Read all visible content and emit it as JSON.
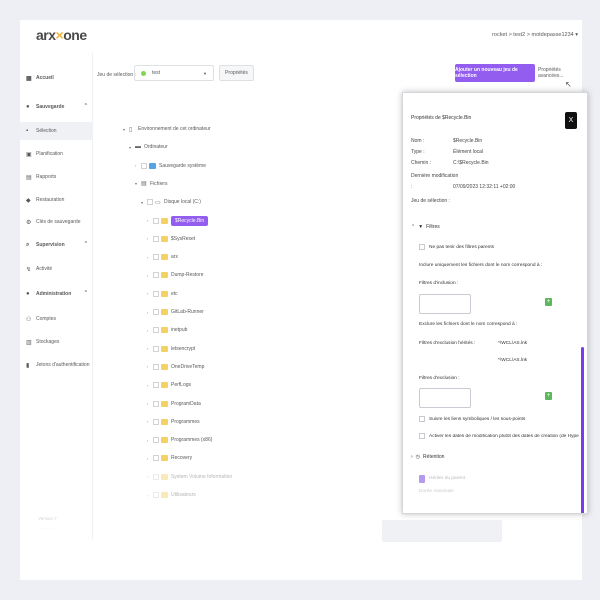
{
  "header": {
    "logo_left": "arx",
    "logo_accent": "×",
    "logo_right": "one",
    "user_menu": "rocket > test2 > motdepasse1234 ▾"
  },
  "sidebar": {
    "items": [
      {
        "label": "Accueil",
        "icon": "home-icon",
        "type": "section"
      },
      {
        "label": "Sauvegarde",
        "icon": "save-icon",
        "type": "section",
        "expanded": true
      },
      {
        "label": "Sélection",
        "icon": "file-icon",
        "type": "item",
        "active": true
      },
      {
        "label": "Planification",
        "icon": "calendar-icon",
        "type": "item"
      },
      {
        "label": "Rapports",
        "icon": "report-icon",
        "type": "item"
      },
      {
        "label": "Restauration",
        "icon": "restore-icon",
        "type": "item"
      },
      {
        "label": "Clés de sauvegarde",
        "icon": "key-icon",
        "type": "item"
      },
      {
        "label": "Supervision",
        "icon": "search-icon",
        "type": "section",
        "expanded": true
      },
      {
        "label": "Activité",
        "icon": "activity-icon",
        "type": "item"
      },
      {
        "label": "Administration",
        "icon": "admin-icon",
        "type": "section",
        "expanded": true
      },
      {
        "label": "Comptes",
        "icon": "users-icon",
        "type": "item"
      },
      {
        "label": "Stockages",
        "icon": "storage-icon",
        "type": "item"
      },
      {
        "label": "Jetons d'authentification",
        "icon": "token-icon",
        "type": "item"
      }
    ],
    "footer_line1": "Version 7",
    "footer_line2": "· · · · · ·"
  },
  "toolbar": {
    "selection_label": "Jeu de sélection :",
    "selection_value": "test",
    "properties_button": "Propriétés",
    "add_button": "Ajouter un nouveau jeu de sélection",
    "advanced_button": "Propriétés avancées..."
  },
  "tree": [
    {
      "label": "Environnement de cet ordinateur",
      "depth": 0,
      "toggle": "▾",
      "icon": "computer-icon",
      "checkbox": false
    },
    {
      "label": "Ordinateur",
      "depth": 1,
      "toggle": "▾",
      "icon": "monitor-icon",
      "checkbox": false
    },
    {
      "label": "Sauvegarde système",
      "depth": 2,
      "toggle": "›",
      "icon": "windows-icon",
      "checkbox": true
    },
    {
      "label": "Fichiers",
      "depth": 2,
      "toggle": "▾",
      "icon": "drive-icon",
      "checkbox": false
    },
    {
      "label": "Disque local (C:)",
      "depth": 3,
      "toggle": "▾",
      "icon": "disk-icon",
      "checkbox": true
    },
    {
      "label": "$Recycle.Bin",
      "depth": 4,
      "toggle": "›",
      "icon": "folder-icon",
      "checkbox": true,
      "selected": true
    },
    {
      "label": "$SysReset",
      "depth": 4,
      "toggle": "›",
      "icon": "folder-icon",
      "checkbox": true
    },
    {
      "label": "arx",
      "depth": 4,
      "toggle": "›",
      "icon": "folder-icon",
      "checkbox": true
    },
    {
      "label": "Dump-Restore",
      "depth": 4,
      "toggle": "›",
      "icon": "folder-icon",
      "checkbox": true
    },
    {
      "label": "etc",
      "depth": 4,
      "toggle": "›",
      "icon": "folder-icon",
      "checkbox": true
    },
    {
      "label": "GitLab-Runner",
      "depth": 4,
      "toggle": "›",
      "icon": "folder-icon",
      "checkbox": true
    },
    {
      "label": "inetpub",
      "depth": 4,
      "toggle": "›",
      "icon": "folder-icon",
      "checkbox": true
    },
    {
      "label": "letsencrypt",
      "depth": 4,
      "toggle": "›",
      "icon": "folder-icon",
      "checkbox": true
    },
    {
      "label": "OneDriveTemp",
      "depth": 4,
      "toggle": "›",
      "icon": "folder-icon",
      "checkbox": true
    },
    {
      "label": "PerfLogs",
      "depth": 4,
      "toggle": "›",
      "icon": "folder-icon",
      "checkbox": true
    },
    {
      "label": "ProgramData",
      "depth": 4,
      "toggle": "›",
      "icon": "folder-icon",
      "checkbox": true
    },
    {
      "label": "Programmes",
      "depth": 4,
      "toggle": "›",
      "icon": "folder-icon",
      "checkbox": true
    },
    {
      "label": "Programmes (x86)",
      "depth": 4,
      "toggle": "›",
      "icon": "folder-icon",
      "checkbox": true
    },
    {
      "label": "Recovery",
      "depth": 4,
      "toggle": "›",
      "icon": "folder-icon",
      "checkbox": true
    },
    {
      "label": "System Volume Information",
      "depth": 4,
      "toggle": "›",
      "icon": "folder-icon",
      "checkbox": true,
      "faded": true
    },
    {
      "label": "Utilisateurs",
      "depth": 4,
      "toggle": "›",
      "icon": "folder-icon",
      "checkbox": true,
      "faded": true
    }
  ],
  "panel": {
    "title": "Propriétés de $Recycle.Bin",
    "close": "X",
    "name_label": "Nom :",
    "name_value": "$Recycle.Bin",
    "type_label": "Type :",
    "type_value": "Élément local",
    "path_label": "Chemin :",
    "path_value": "C:\\$Recycle.Bin",
    "modified_label": "Dernière modification",
    "modified_colon": ":",
    "modified_value": "07/09/2023 12:32:11 +02:00",
    "selection_set_label": "Jeu de sélection :",
    "filters_label": "Filtres",
    "no_parent_filters": "Ne pas tenir des filtres parents",
    "include_heading": "Inclure uniquement les fichiers dont le nom correspond à :",
    "include_filters_label": "Filtres d'inclusion :",
    "exclude_heading": "Exclure les fichiers dont le nom correspond à :",
    "inherited_exclusion_label": "Filtres d'exclusion hérités :",
    "inherited_exclusion_1": "*\\WCL\\AS.lnk",
    "inherited_exclusion_2": "*\\WCL\\AS.lnk",
    "exclusion_filters_label": "Filtres d'exclusion :",
    "follow_symlinks": "Suivre les liens symboliques / les sous-points",
    "use_change_date": "Activer les dates de modification plutôt des dates de création (de Hyper-V)",
    "retention_label": "Rétention",
    "add_glyph": "+",
    "faded_row_text": "Hériter du parent",
    "faded_line_text": "Durée maximale"
  }
}
